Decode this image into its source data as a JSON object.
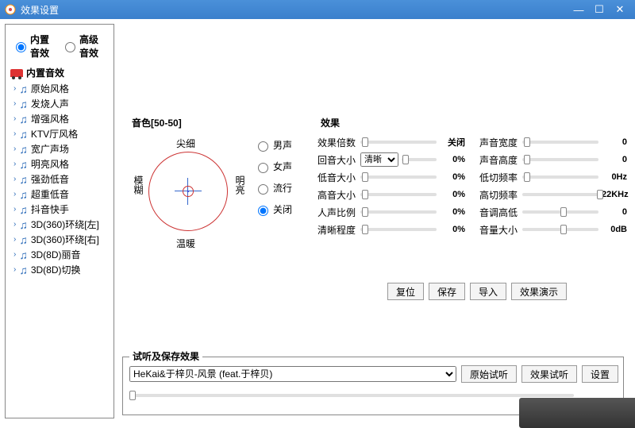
{
  "window": {
    "title": "效果设置"
  },
  "modes": {
    "builtin": "内置音效",
    "advanced": "高级音效",
    "selected": "builtin"
  },
  "tree": {
    "header": "内置音效",
    "presets": [
      "原始风格",
      "发烧人声",
      "增强风格",
      "KTV厅风格",
      "宽广声场",
      "明亮风格",
      "强劲低音",
      "超重低音",
      "抖音快手",
      "3D(360)环绕[左]",
      "3D(360)环绕[右]",
      "3D(8D)丽音",
      "3D(8D)切换"
    ]
  },
  "tone": {
    "legend": "音色[50-50]",
    "labels": {
      "top": "尖细",
      "bottom": "温暖",
      "left": "模糊",
      "right": "明亮"
    },
    "voices": [
      "男声",
      "女声",
      "流行",
      "关闭"
    ],
    "voice_selected": "关闭"
  },
  "effects": {
    "legend": "效果",
    "left": [
      {
        "label": "效果倍数",
        "value": "关闭",
        "thumb": 2
      },
      {
        "label": "回音大小",
        "value": "0%",
        "dropdown": "清晰",
        "thumb": 2
      },
      {
        "label": "低音大小",
        "value": "0%",
        "thumb": 2
      },
      {
        "label": "高音大小",
        "value": "0%",
        "thumb": 2
      },
      {
        "label": "人声比例",
        "value": "0%",
        "thumb": 2
      },
      {
        "label": "清晰程度",
        "value": "0%",
        "thumb": 2
      }
    ],
    "right": [
      {
        "label": "声音宽度",
        "value": "0",
        "thumb": 2
      },
      {
        "label": "声音高度",
        "value": "0",
        "thumb": 2
      },
      {
        "label": "低切频率",
        "value": "0Hz",
        "thumb": 2
      },
      {
        "label": "高切频率",
        "value": "22KHz",
        "thumb": 98
      },
      {
        "label": "音调高低",
        "value": "0",
        "thumb": 50
      },
      {
        "label": "音量大小",
        "value": "0dB",
        "thumb": 50
      }
    ]
  },
  "buttons": {
    "reset": "复位",
    "save": "保存",
    "import": "导入",
    "demo": "效果演示"
  },
  "preview": {
    "legend": "试听及保存效果",
    "track": "HeKai&于梓贝-风景 (feat.于梓贝)",
    "btn_orig": "原始试听",
    "btn_fx": "效果试听",
    "btn_set": "设置"
  }
}
